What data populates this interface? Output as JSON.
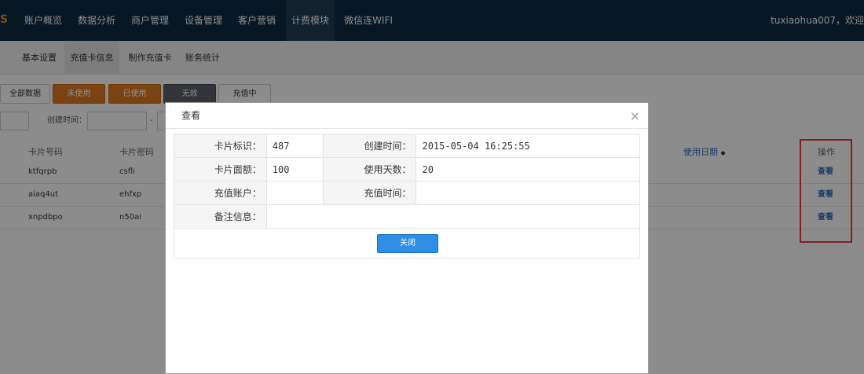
{
  "logo": "S",
  "nav": [
    "账户概览",
    "数据分析",
    "商户管理",
    "设备管理",
    "客户营销",
    "计费模块",
    "微信连WIFI"
  ],
  "user": "tuxiaohua007，欢迎",
  "subnav": [
    "基本设置",
    "充值卡信息",
    "制作充值卡",
    "账务统计"
  ],
  "filters": [
    "全部数据",
    "未使用",
    "已使用",
    "无效",
    "充值中"
  ],
  "date_label": "创建时间：",
  "date_sep": "-",
  "table": {
    "headers": [
      "卡片号码",
      "卡片密码",
      "使用日期",
      "操作"
    ],
    "sort_glyph": "◆",
    "rows": [
      {
        "number": "ktfqrpb",
        "password": "csfli",
        "action": "查看"
      },
      {
        "number": "aiaq4ut",
        "password": "ehfxp",
        "action": "查看"
      },
      {
        "number": "xnpdbpo",
        "password": "n50ai",
        "action": "查看"
      }
    ]
  },
  "modal": {
    "title": "查看",
    "close_glyph": "×",
    "fields": {
      "card_id_label": "卡片标识：",
      "card_id": "487",
      "created_label": "创建时间：",
      "created": "2015-05-04 16:25:55",
      "amount_label": "卡片面额：",
      "amount": "100",
      "days_label": "使用天数：",
      "days": "20",
      "account_label": "充值账户：",
      "account": "",
      "recharge_label": "充值时间：",
      "recharge": "",
      "remark_label": "备注信息：",
      "remark": ""
    },
    "close_button": "关闭"
  },
  "colors": {
    "nav_bg": "#0d2a42",
    "orange": "#e07b1f",
    "blue": "#2e8de4",
    "highlight": "#e23b3b"
  }
}
